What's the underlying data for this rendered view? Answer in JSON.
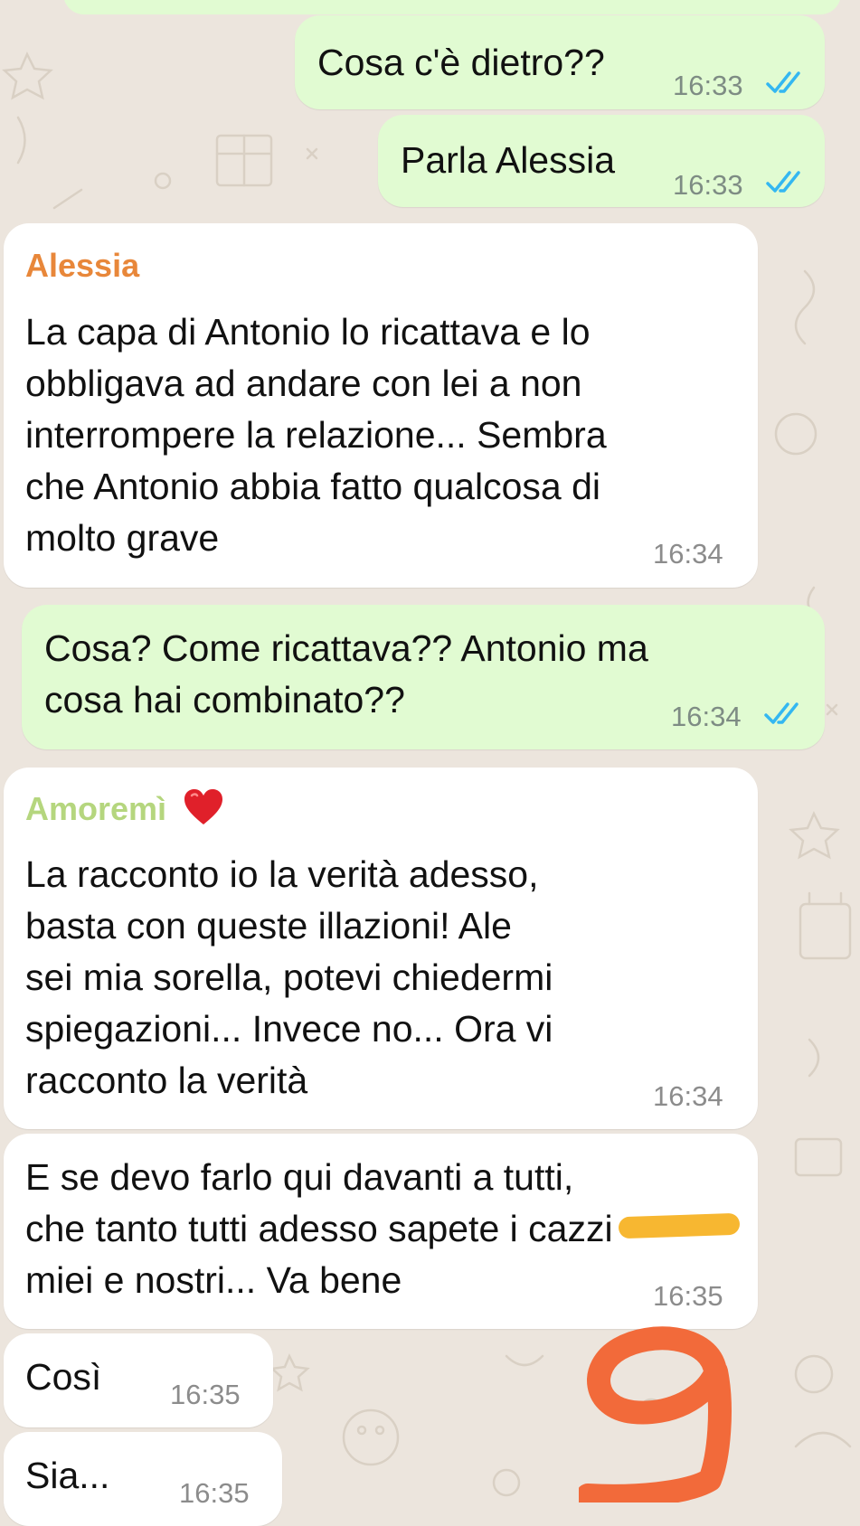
{
  "messages": [
    {
      "text": "Cosa c'è dietro??",
      "time": "16:33"
    },
    {
      "text": "Parla Alessia",
      "time": "16:33"
    },
    {
      "sender": "Alessia",
      "lines": [
        "La capa di Antonio lo ricattava e lo",
        "obbligava ad andare con lei a non",
        "interrompere la relazione... Sembra",
        "che Antonio abbia fatto qualcosa di",
        "molto grave"
      ],
      "time": "16:34"
    },
    {
      "lines": [
        "Cosa? Come ricattava?? Antonio ma",
        "cosa hai combinato??"
      ],
      "time": "16:34"
    },
    {
      "sender": "Amoremì",
      "lines": [
        "La racconto io la verità adesso,",
        "basta con queste illazioni! Ale",
        "sei mia sorella, potevi chiedermi",
        "spiegazioni... Invece no... Ora vi",
        "racconto la verità"
      ],
      "time": "16:34"
    },
    {
      "lines": [
        "E se devo farlo qui davanti a tutti,",
        "che tanto tutti adesso sapete i cazzi",
        "miei e nostri... Va bene"
      ],
      "time": "16:35"
    },
    {
      "text": "Così",
      "time": "16:35"
    },
    {
      "text": "Sia...",
      "time": "16:35"
    }
  ],
  "annotation": {
    "text": "9",
    "color": "#F26A3A"
  },
  "censor": {
    "color": "#F7B731"
  },
  "colors": {
    "sent_bubble": "#E1FBD2",
    "received_bubble": "#FFFFFF",
    "background": "#ECE5DD",
    "read_ticks": "#34B7F1",
    "sender_alessia": "#E8873A",
    "sender_amoremi": "#B5D67E"
  },
  "icons": {
    "read_receipt": "double-check-icon",
    "heart": "red-heart-icon"
  }
}
